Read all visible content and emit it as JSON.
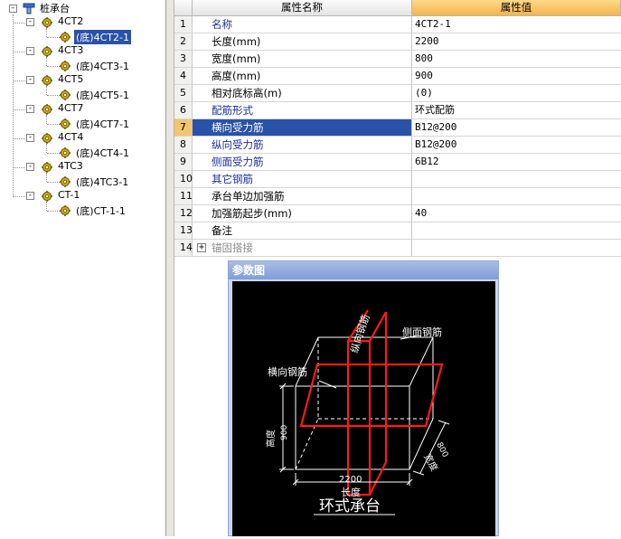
{
  "tree": {
    "root": "桩承台",
    "groups": [
      {
        "name": "4CT2",
        "child": "(底)4CT2-1",
        "selected": true
      },
      {
        "name": "4CT3",
        "child": "(底)4CT3-1"
      },
      {
        "name": "4CT5",
        "child": "(底)4CT5-1"
      },
      {
        "name": "4CT7",
        "child": "(底)4CT7-1"
      },
      {
        "name": "4CT4",
        "child": "(底)4CT4-1"
      },
      {
        "name": "4TC3",
        "child": "(底)4TC3-1"
      },
      {
        "name": "CT-1",
        "child": "(底)CT-1-1"
      }
    ]
  },
  "grid": {
    "header_name": "属性名称",
    "header_value": "属性值",
    "rows": [
      {
        "num": "1",
        "name": "名称",
        "value": "4CT2-1",
        "blue": true
      },
      {
        "num": "2",
        "name": "长度(mm)",
        "value": "2200"
      },
      {
        "num": "3",
        "name": "宽度(mm)",
        "value": "800"
      },
      {
        "num": "4",
        "name": "高度(mm)",
        "value": "900"
      },
      {
        "num": "5",
        "name": "相对底标高(m)",
        "value": "(0)"
      },
      {
        "num": "6",
        "name": "配筋形式",
        "value": "环式配筋",
        "blue": true
      },
      {
        "num": "7",
        "name": "横向受力筋",
        "value": "B12@200",
        "blue": true,
        "selected": true
      },
      {
        "num": "8",
        "name": "纵向受力筋",
        "value": "B12@200",
        "blue": true
      },
      {
        "num": "9",
        "name": "侧面受力筋",
        "value": "6B12",
        "blue": true
      },
      {
        "num": "10",
        "name": "其它钢筋",
        "value": "",
        "blue": true
      },
      {
        "num": "11",
        "name": "承台单边加强筋",
        "value": ""
      },
      {
        "num": "12",
        "name": "加强筋起步(mm)",
        "value": "40"
      },
      {
        "num": "13",
        "name": "备注",
        "value": ""
      },
      {
        "num": "14",
        "name": "锚固搭接",
        "value": "",
        "gray": true,
        "expandable": true,
        "expand_symbol": "+"
      }
    ]
  },
  "param_window": {
    "title": "参数图",
    "labels": {
      "longitudinal": "纵向钢筋",
      "side": "侧面钢筋",
      "transverse": "横向钢筋",
      "height_name": "高度",
      "height_value": "900",
      "length_value": "2200",
      "length_name": "长度",
      "width_value": "800",
      "width_name": "宽度",
      "caption": "环式承台"
    }
  },
  "icons": {
    "tree_root": "tree-root-icon",
    "tree_node": "gear-icon"
  },
  "colors": {
    "selection": "#2a52a8",
    "header_value_bg": "#f3b44c",
    "rebar": "#ff1a1a",
    "link_text": "#1a2ea0"
  }
}
